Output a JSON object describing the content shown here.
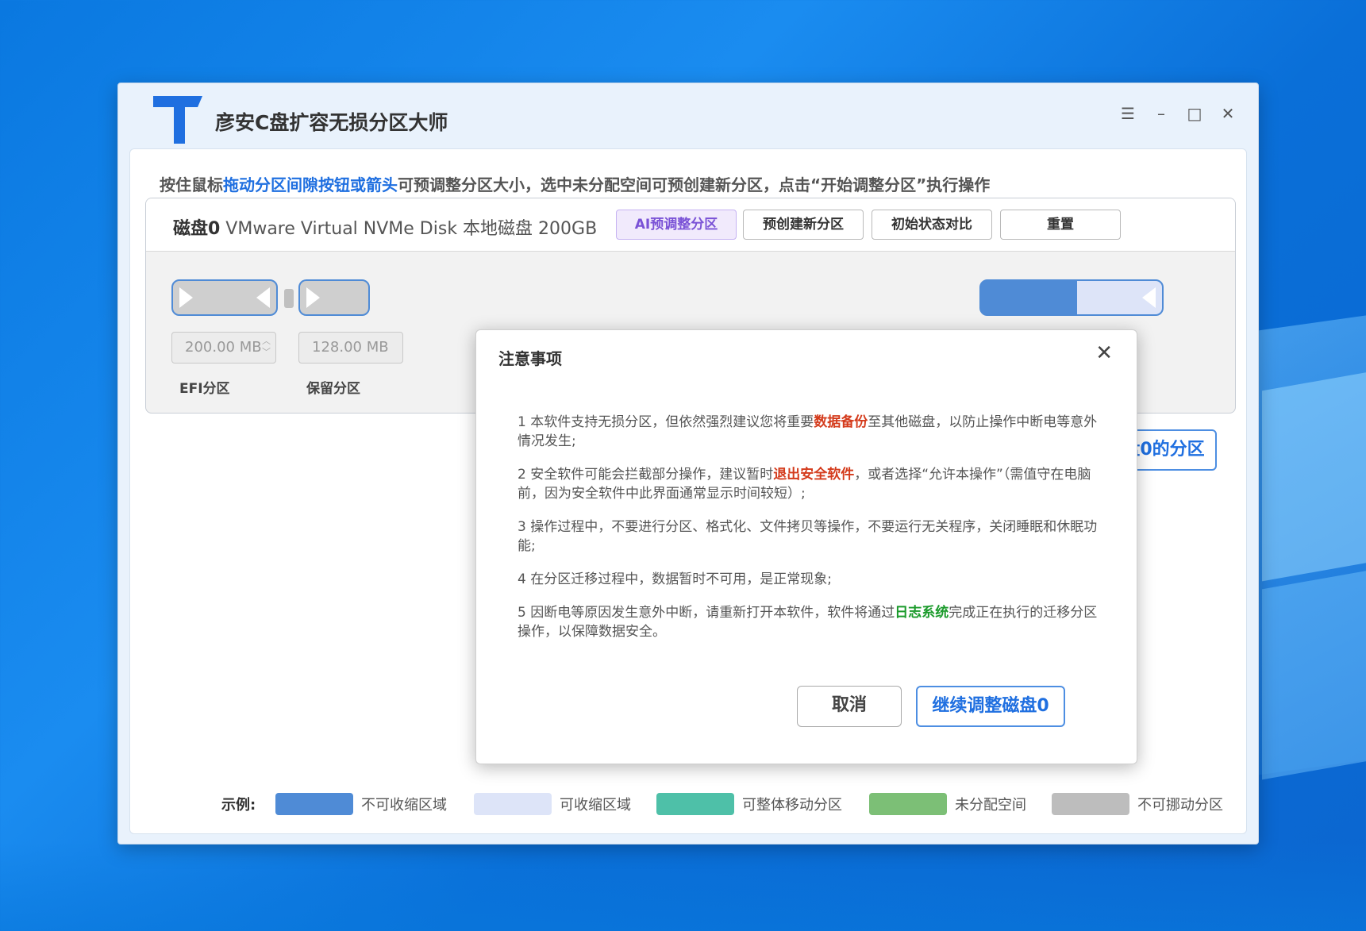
{
  "app": {
    "title": "彦安C盘扩容无损分区大师",
    "logo_letter": "T",
    "window_controls": {
      "menu_icon": "menu-icon",
      "min_icon": "minimize-icon",
      "max_icon": "maximize-icon",
      "close_icon": "close-icon"
    }
  },
  "hint": {
    "part1": "按住鼠标",
    "part2": "拖动分区间隙按钮或箭头",
    "part3": "可预调整分区大小，选中未分配空间可预创建新分区，点击“开始调整分区”执行操作"
  },
  "disk": {
    "name": "磁盘0",
    "desc": " VMware Virtual NVMe Disk 本地磁盘 200GB",
    "buttons": {
      "ai": "AI预调整分区",
      "create": "预创建新分区",
      "compare": "初始状态对比",
      "reset": "重置"
    },
    "partitions": [
      {
        "label": "EFI分区",
        "size": "200.00 MB"
      },
      {
        "label": "保留分区",
        "size": "128.00 MB"
      }
    ]
  },
  "start_button": "开始调整磁盘0的分区",
  "legend": {
    "title": "示例:",
    "items": [
      {
        "label": "不可收缩区域",
        "color": "#4f8bd6"
      },
      {
        "label": "可收缩区域",
        "color": "#dde4f8"
      },
      {
        "label": "可整体移动分区",
        "color": "#4ec0a8"
      },
      {
        "label": "未分配空间",
        "color": "#7cbf76"
      },
      {
        "label": "不可挪动分区",
        "color": "#bdbdbd"
      }
    ]
  },
  "colors": {
    "accent": "#1f6fe0",
    "warn": "#d43b1c",
    "ok": "#1a9a2a"
  },
  "modal": {
    "title": "注意事项",
    "n1": {
      "a": "1 本软件支持无损分区，但依然强烈建议您将重要",
      "b": "数据备份",
      "c": "至其他磁盘，以防止操作中断电等意外情况发生;"
    },
    "n2": {
      "a": "2 安全软件可能会拦截部分操作，建议暂时",
      "b": "退出安全软件",
      "c": "，或者选择“允许本操作”（需值守在电脑前，因为安全软件中此界面通常显示时间较短）;"
    },
    "n3": "3 操作过程中，不要进行分区、格式化、文件拷贝等操作，不要运行无关程序，关闭睡眠和休眠功能;",
    "n4": "4 在分区迁移过程中，数据暂时不可用，是正常现象;",
    "n5": {
      "a": "5 因断电等原因发生意外中断，请重新打开本软件，软件将通过",
      "b": "日志系统",
      "c": "完成正在执行的迁移分区操作，以保障数据安全。"
    },
    "cancel": "取消",
    "confirm": "继续调整磁盘0"
  }
}
